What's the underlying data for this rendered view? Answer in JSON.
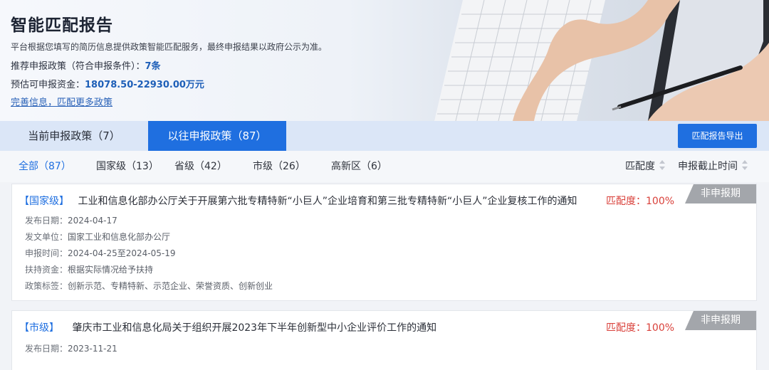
{
  "hero": {
    "title": "智能匹配报告",
    "description": "平台根据您填写的简历信息提供政策智能匹配服务，最终申报结果以政府公示为准。",
    "recommend_label": "推荐申报政策（符合申报条件）：",
    "recommend_value": "7条",
    "fund_label": "预估可申报资金：",
    "fund_value": "18078.50-22930.00万元",
    "link": "完善信息，匹配更多政策"
  },
  "tabs": [
    {
      "label": "当前申报政策（7）",
      "active": false
    },
    {
      "label": "以往申报政策（87）",
      "active": true
    }
  ],
  "export_button": "匹配报告导出",
  "filters": [
    {
      "label": "全部（87）",
      "active": true
    },
    {
      "label": "国家级（13）",
      "active": false
    },
    {
      "label": "省级（42）",
      "active": false
    },
    {
      "label": "市级（26）",
      "active": false
    },
    {
      "label": "高新区（6）",
      "active": false
    }
  ],
  "sorts": [
    {
      "label": "匹配度",
      "icon": "sort-icon"
    },
    {
      "label": "申报截止时间",
      "icon": "sort-icon"
    }
  ],
  "cards": [
    {
      "level": "【国家级】",
      "title": "工业和信息化部办公厅关于开展第六批专精特新“小巨人”企业培育和第三批专精特新“小巨人”企业复核工作的通知",
      "match": "匹配度：100%",
      "status": "非申报期",
      "meta": [
        {
          "k": "发布日期：",
          "v": "2024-04-17"
        },
        {
          "k": "发文单位：",
          "v": "国家工业和信息化部办公厅"
        },
        {
          "k": "申报时间：",
          "v": "2024-04-25至2024-05-19"
        },
        {
          "k": "扶持资金：",
          "v": "根据实际情况给予扶持"
        },
        {
          "k": "政策标签：",
          "v": "创新示范、专精特新、示范企业、荣誉资质、创新创业"
        }
      ]
    },
    {
      "level": "【市级】",
      "title": "肇庆市工业和信息化局关于组织开展2023年下半年创新型中小企业评价工作的通知",
      "match": "匹配度：100%",
      "status": "非申报期",
      "meta": [
        {
          "k": "发布日期：",
          "v": "2023-11-21"
        }
      ]
    }
  ],
  "colors": {
    "accent": "#1f6fe0",
    "match_red": "#d9403a",
    "ribbon_gray": "#a3a6ab"
  }
}
